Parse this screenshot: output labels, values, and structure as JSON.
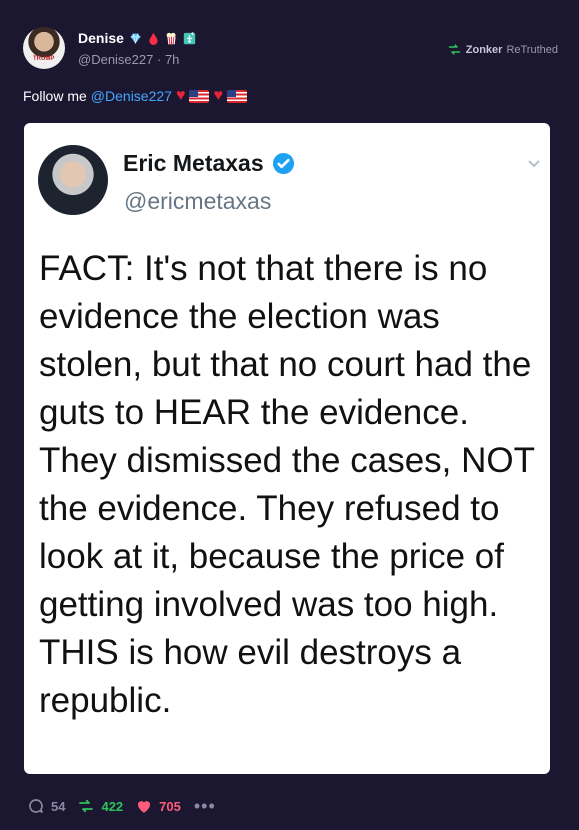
{
  "post": {
    "display_name": "Denise",
    "handle": "@Denise227",
    "time": "7h",
    "avatar_text": "TRUMP",
    "retruthed_by": "Zonker",
    "retruthed_label": "ReTruthed",
    "text_prefix": "Follow me",
    "mention": "@Denise227"
  },
  "quoted_tweet": {
    "name": "Eric Metaxas",
    "handle": "@ericmetaxas",
    "body": "FACT: It's not that there is no evidence the election was stolen, but that no court had the guts to HEAR the evidence. They dismissed the cases, NOT the evidence. They refused to look at it, because the price of getting involved was too high. THIS is how evil destroys a republic."
  },
  "actions": {
    "replies": "54",
    "retruths": "422",
    "likes": "705",
    "more": "•••"
  },
  "colors": {
    "background": "#1c1730",
    "mention": "#45a6ff",
    "retruth": "#2fc25b",
    "like": "#ff5b7a",
    "verified": "#1da1f2"
  },
  "icons": {
    "name_badges": [
      "diamond-icon",
      "blood-drop-icon",
      "popcorn-icon",
      "statue-of-liberty-icon"
    ],
    "text_emojis": [
      "heart-icon",
      "us-flag-icon",
      "heart-icon",
      "us-flag-icon"
    ]
  }
}
